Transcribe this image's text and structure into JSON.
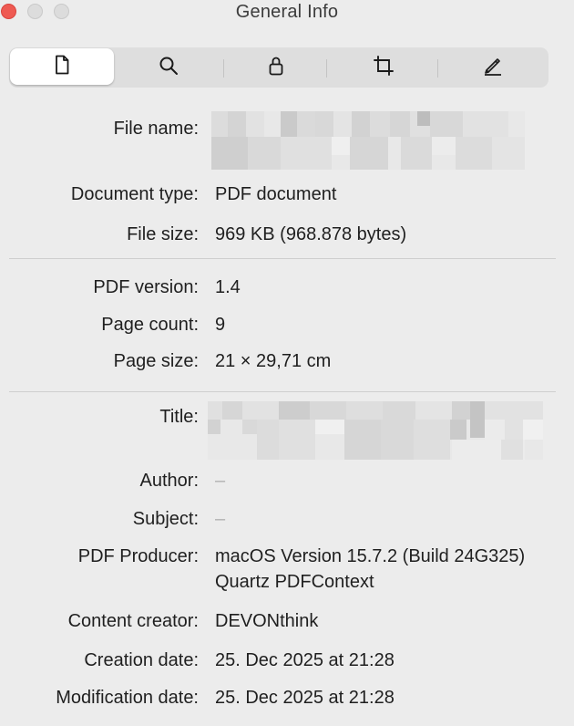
{
  "window": {
    "title": "General Info"
  },
  "toolbar": {
    "tabs": [
      {
        "name": "general",
        "icon": "document-icon",
        "active": true
      },
      {
        "name": "search",
        "icon": "magnifier-icon",
        "active": false
      },
      {
        "name": "security",
        "icon": "lock-icon",
        "active": false
      },
      {
        "name": "crop",
        "icon": "crop-icon",
        "active": false
      },
      {
        "name": "annotate",
        "icon": "pen-icon",
        "active": false
      }
    ]
  },
  "info": {
    "file_name_label": "File name:",
    "document_type_label": "Document type:",
    "document_type": "PDF document",
    "file_size_label": "File size:",
    "file_size": "969 KB (968.878 bytes)",
    "pdf_version_label": "PDF version:",
    "pdf_version": "1.4",
    "page_count_label": "Page count:",
    "page_count": "9",
    "page_size_label": "Page size:",
    "page_size": "21 × 29,71 cm",
    "title_label": "Title:",
    "author_label": "Author:",
    "author": "–",
    "subject_label": "Subject:",
    "subject": "–",
    "producer_label": "PDF Producer:",
    "producer": "macOS Version 15.7.2 (Build 24G325) Quartz PDFContext",
    "creator_label": "Content creator:",
    "creator": "DEVONthink",
    "creation_label": "Creation date:",
    "creation_date": "25. Dec 2025 at 21:28",
    "modification_label": "Modification date:",
    "modification_date": "25. Dec 2025 at 21:28"
  },
  "colors": {
    "background": "#ececec",
    "close": "#ee5a52",
    "segment_bg": "#dedede",
    "redaction": "#d6d6d6"
  }
}
